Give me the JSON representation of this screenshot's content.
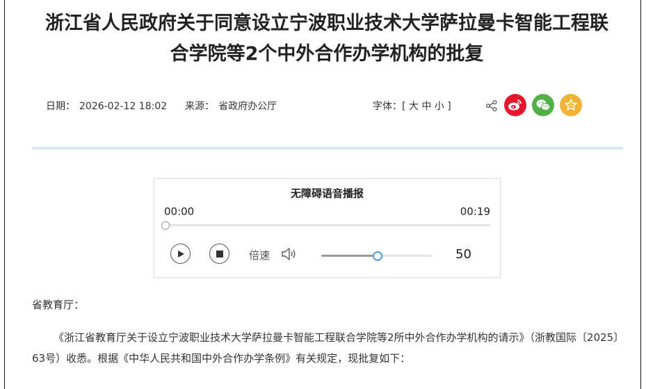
{
  "article": {
    "title_line1": "浙江省人民政府关于同意设立宁波职业技术大学萨拉曼卡智能工程联",
    "title_line2": "合学院等2个中外合作办学机构的批复",
    "date_label": "日期：",
    "date_value": "2026-02-12 18:02",
    "source_label": "来源：",
    "source_value": "省政府办公厅",
    "font_label": "字体：",
    "font_options": "[ 大 中 小 ]"
  },
  "share": {
    "icons": [
      "share-icon",
      "weibo-icon",
      "wechat-icon",
      "favorite-icon"
    ],
    "colors": {
      "weibo": "#e6162d",
      "wechat": "#51b045",
      "favorite": "#f2b236"
    }
  },
  "audio_player": {
    "title": "无障碍语音播报",
    "current_time": "00:00",
    "duration": "00:19",
    "progress": 0,
    "speed_label": "倍速",
    "volume": 50,
    "accent_color": "#4a9ee8"
  },
  "content": {
    "addressee": "省教育厅：",
    "paragraph1": "《浙江省教育厅关于设立宁波职业技术大学萨拉曼卡智能工程联合学院等2所中外合作办学机构的请示》（浙教国际〔2025〕63号）收悉。根据《中华人民共和国中外合作办学条例》有关规定，现批复如下："
  }
}
